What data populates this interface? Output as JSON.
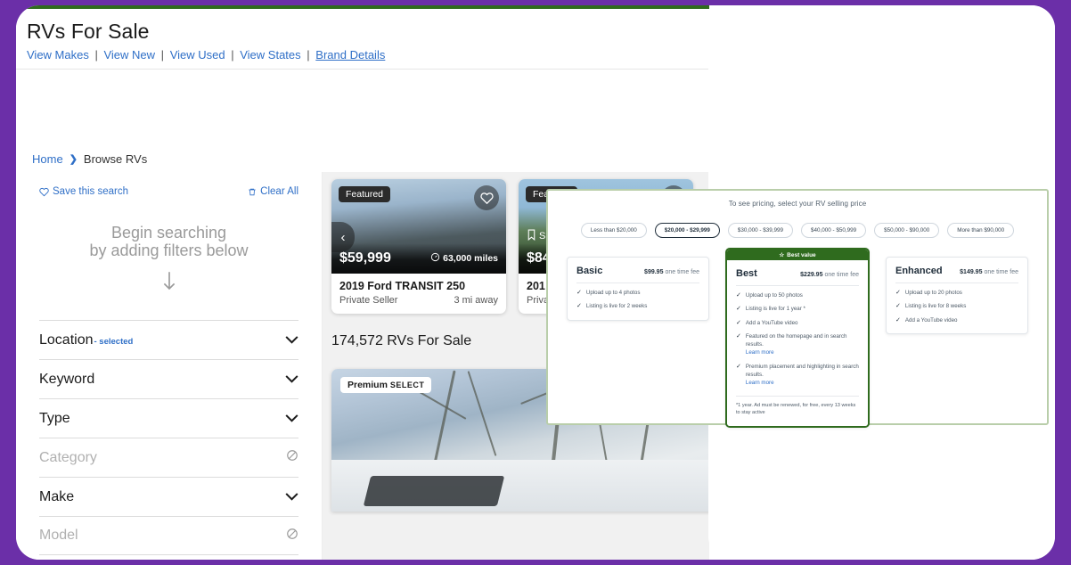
{
  "theme": {
    "frame_purple": "#6b2fa8",
    "accent_blue": "#2f6fc7",
    "best_green": "#2f6b1e",
    "panel_border_green": "#b9ceaa"
  },
  "site_header": {
    "title": "RVs For Sale",
    "links": [
      {
        "label": "View Makes",
        "active": false
      },
      {
        "label": "View New",
        "active": false
      },
      {
        "label": "View Used",
        "active": false
      },
      {
        "label": "View States",
        "active": false
      },
      {
        "label": "Brand Details",
        "active": true
      }
    ],
    "separator": "|"
  },
  "breadcrumb": {
    "home": "Home",
    "chevron": "❯",
    "current": "Browse RVs"
  },
  "sidebar": {
    "save_search": "Save this search",
    "clear_all": "Clear All",
    "begin_line1": "Begin searching",
    "begin_line2": "by adding filters below",
    "arrow": "↓",
    "filters": [
      {
        "label": "Location",
        "tag": "- selected",
        "state": "expandable"
      },
      {
        "label": "Keyword",
        "tag": "",
        "state": "expandable"
      },
      {
        "label": "Type",
        "tag": "",
        "state": "expandable"
      },
      {
        "label": "Category",
        "tag": "",
        "state": "disabled"
      },
      {
        "label": "Make",
        "tag": "",
        "state": "expandable"
      },
      {
        "label": "Model",
        "tag": "",
        "state": "disabled"
      }
    ]
  },
  "results": {
    "count_text": "174,572 RVs For Sale",
    "prev_arrow": "‹",
    "cards": [
      {
        "badge": "Featured",
        "price": "$59,999",
        "miles": "63,000 miles",
        "title": "2019 Ford TRANSIT 250",
        "seller": "Private Seller",
        "distance": "3 mi away"
      },
      {
        "badge": "Featured",
        "price": "$84",
        "miles": "",
        "title": "201",
        "seller": "Priva",
        "distance": "",
        "save_label": "S"
      }
    ],
    "premium_card": {
      "badge_main": "Premium",
      "badge_sub": "SELECT"
    }
  },
  "pricing_panel": {
    "subtitle": "To see pricing, select your RV selling price",
    "price_pills": [
      {
        "label": "Less than $20,000",
        "selected": false
      },
      {
        "label": "$20,000 - $29,999",
        "selected": true
      },
      {
        "label": "$30,000 - $39,999",
        "selected": false
      },
      {
        "label": "$40,000 - $50,999",
        "selected": false
      },
      {
        "label": "$50,000 - $90,000",
        "selected": false
      },
      {
        "label": "More than $90,000",
        "selected": false
      }
    ],
    "best_value_banner": "Best value",
    "best_value_star": "☆",
    "plans": [
      {
        "name": "Basic",
        "price": "$99.95",
        "fee_text": "one time fee",
        "highlight": false,
        "features": [
          {
            "text": "Upload up to 4 photos",
            "learn_more": ""
          },
          {
            "text": "Listing is live for 2 weeks",
            "learn_more": ""
          }
        ],
        "footnote": ""
      },
      {
        "name": "Best",
        "price": "$229.95",
        "fee_text": "one time fee",
        "highlight": true,
        "features": [
          {
            "text": "Upload up to 50 photos",
            "learn_more": ""
          },
          {
            "text": "Listing is live for 1 year *",
            "learn_more": ""
          },
          {
            "text": "Add a YouTube video",
            "learn_more": ""
          },
          {
            "text": "Featured on the homepage and in search results.",
            "learn_more": "Learn more"
          },
          {
            "text": "Premium placement and highlighting in search results.",
            "learn_more": "Learn more"
          }
        ],
        "footnote": "*1 year. Ad must be renewed, for free, every 13 weeks to stay active"
      },
      {
        "name": "Enhanced",
        "price": "$149.95",
        "fee_text": "one time fee",
        "highlight": false,
        "features": [
          {
            "text": "Upload up to 20 photos",
            "learn_more": ""
          },
          {
            "text": "Listing is live for 8 weeks",
            "learn_more": ""
          },
          {
            "text": "Add a YouTube video",
            "learn_more": ""
          }
        ],
        "footnote": ""
      }
    ]
  }
}
